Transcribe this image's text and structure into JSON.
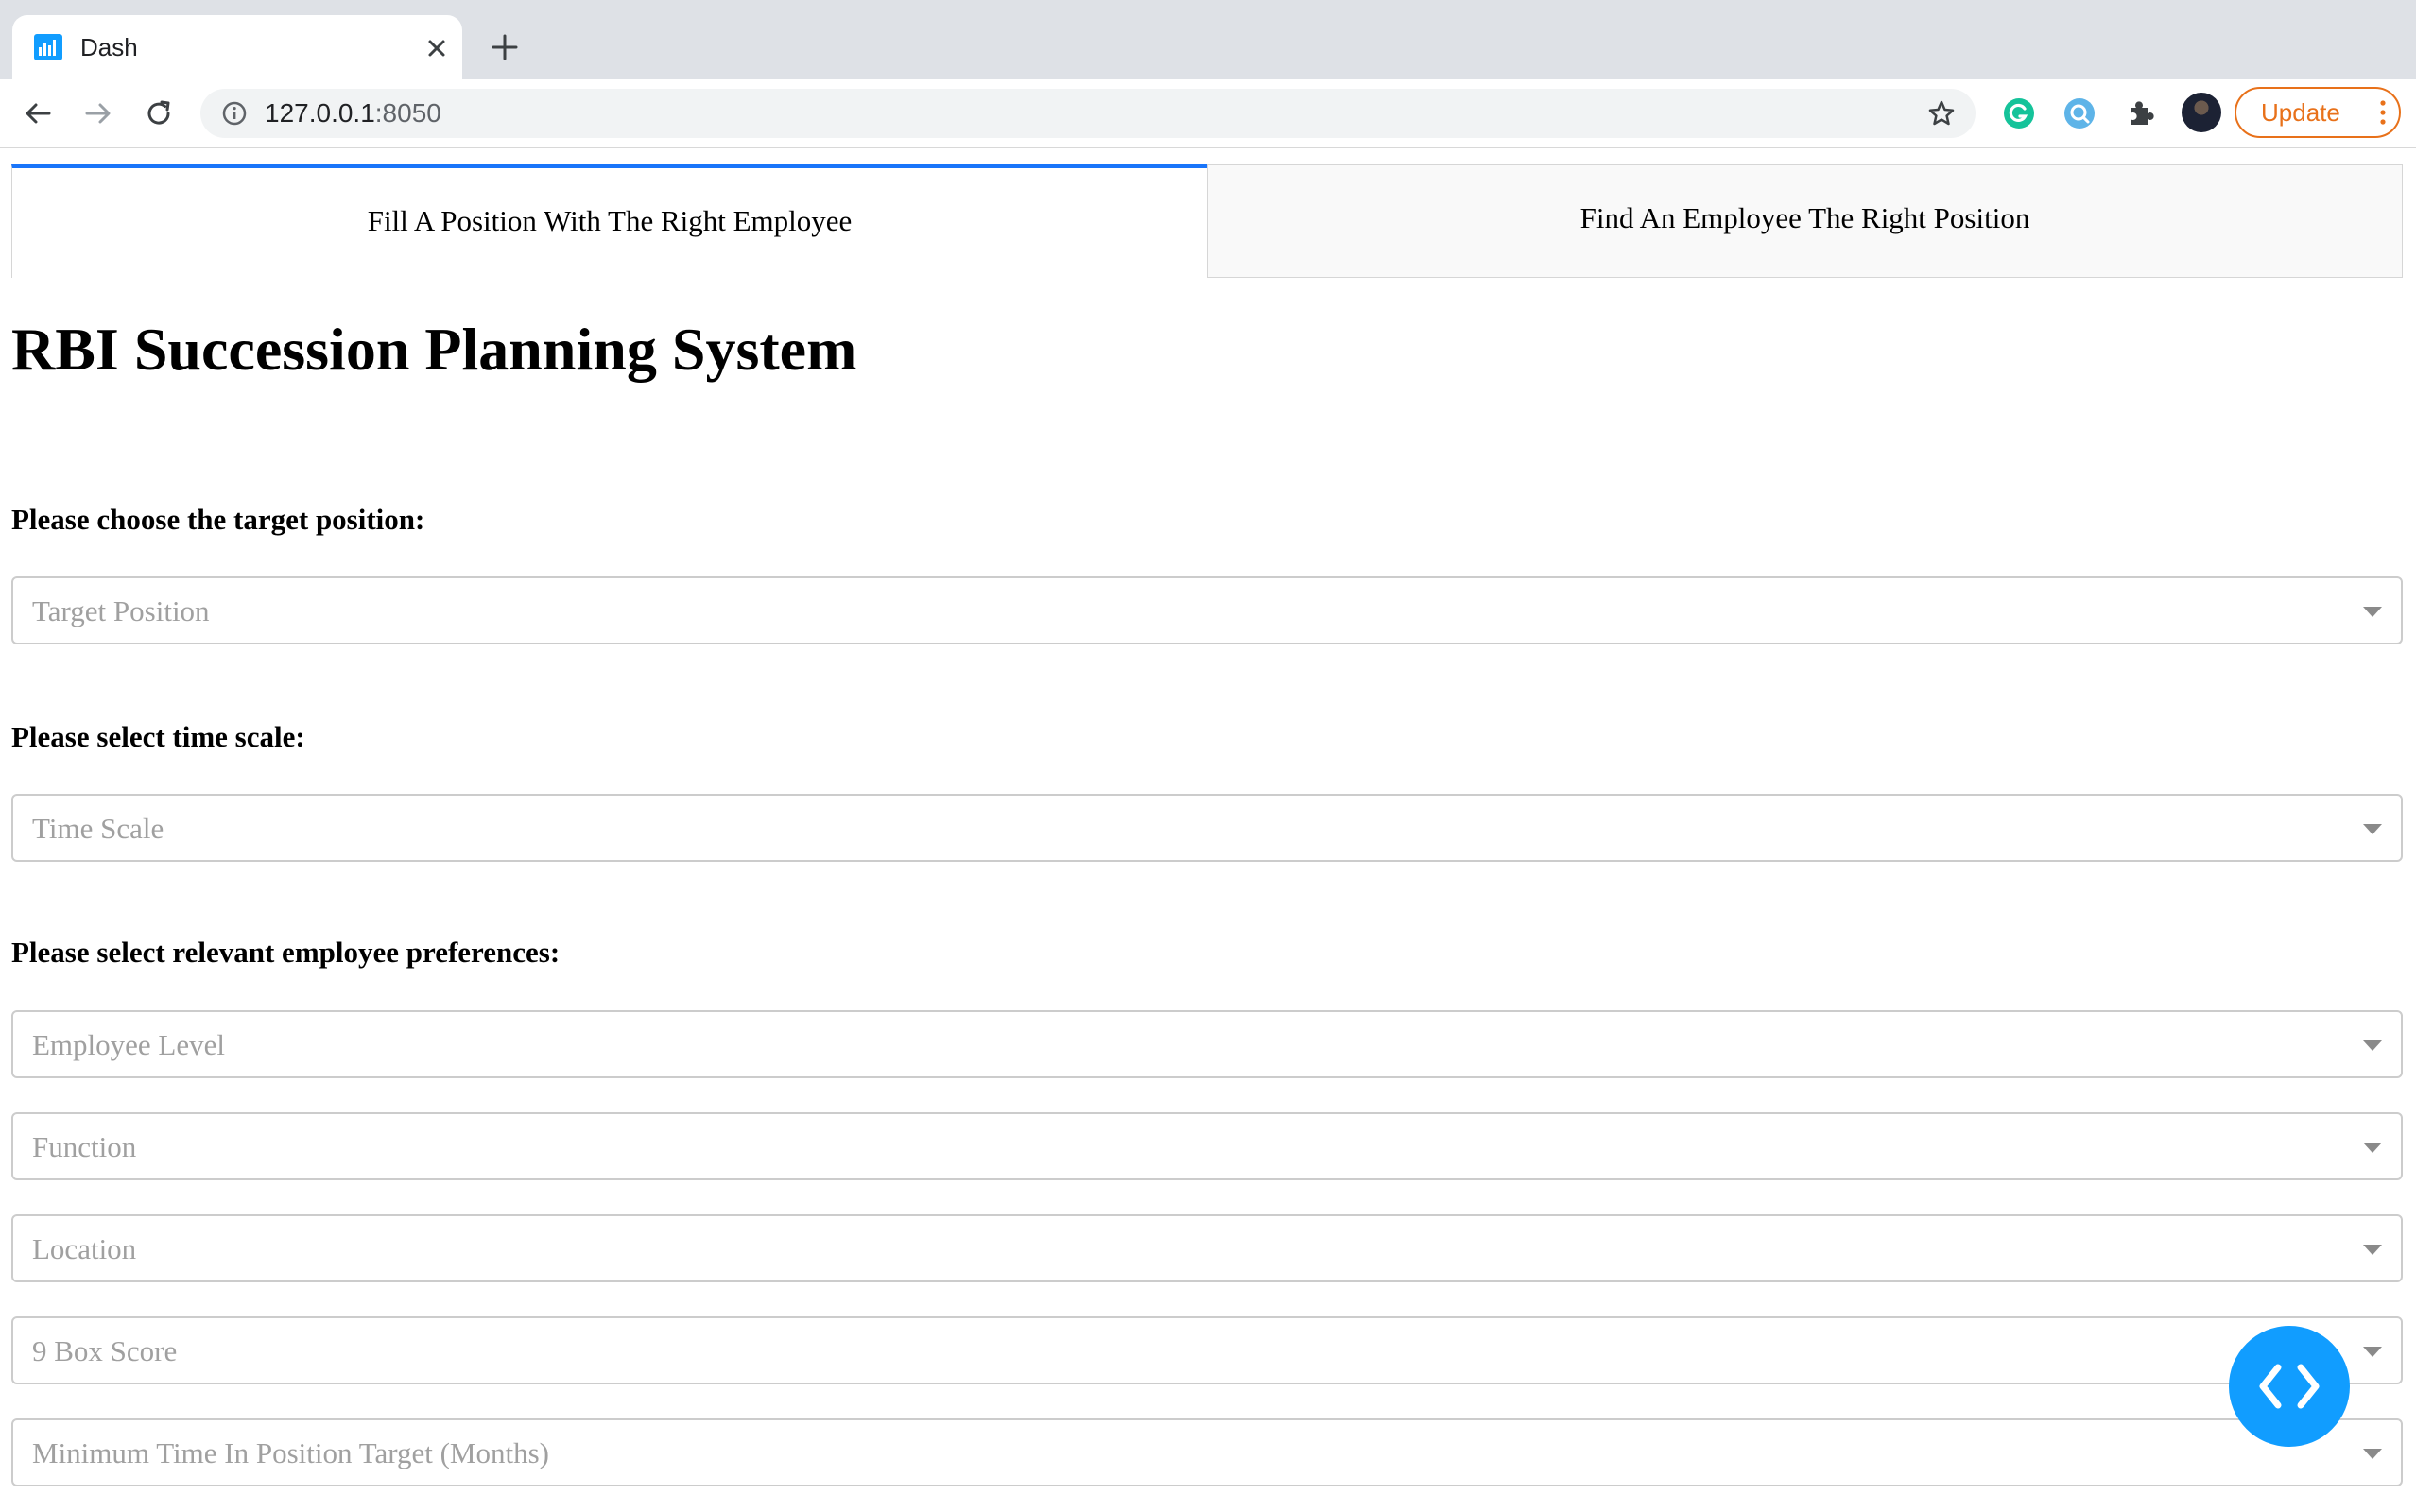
{
  "browser": {
    "tab_title": "Dash",
    "url_host": "127.0.0.1",
    "url_port": ":8050",
    "update_label": "Update"
  },
  "tabs": [
    {
      "label": "Fill A Position With The Right Employee",
      "selected": true
    },
    {
      "label": "Find An Employee The Right Position",
      "selected": false
    }
  ],
  "page": {
    "title": "RBI Succession Planning System",
    "section_position": "Please choose the target position:",
    "section_time": "Please select time scale:",
    "section_preferences": "Please select relevant employee preferences:"
  },
  "dropdowns": {
    "target_position": "Target Position",
    "time_scale": "Time Scale",
    "employee_level": "Employee Level",
    "function": "Function",
    "location": "Location",
    "box_score": "9 Box Score",
    "min_time": "Minimum Time In Position Target (Months)"
  },
  "colors": {
    "active_tab_accent": "#1975fa",
    "fab": "#119dff",
    "update": "#e8711a"
  }
}
